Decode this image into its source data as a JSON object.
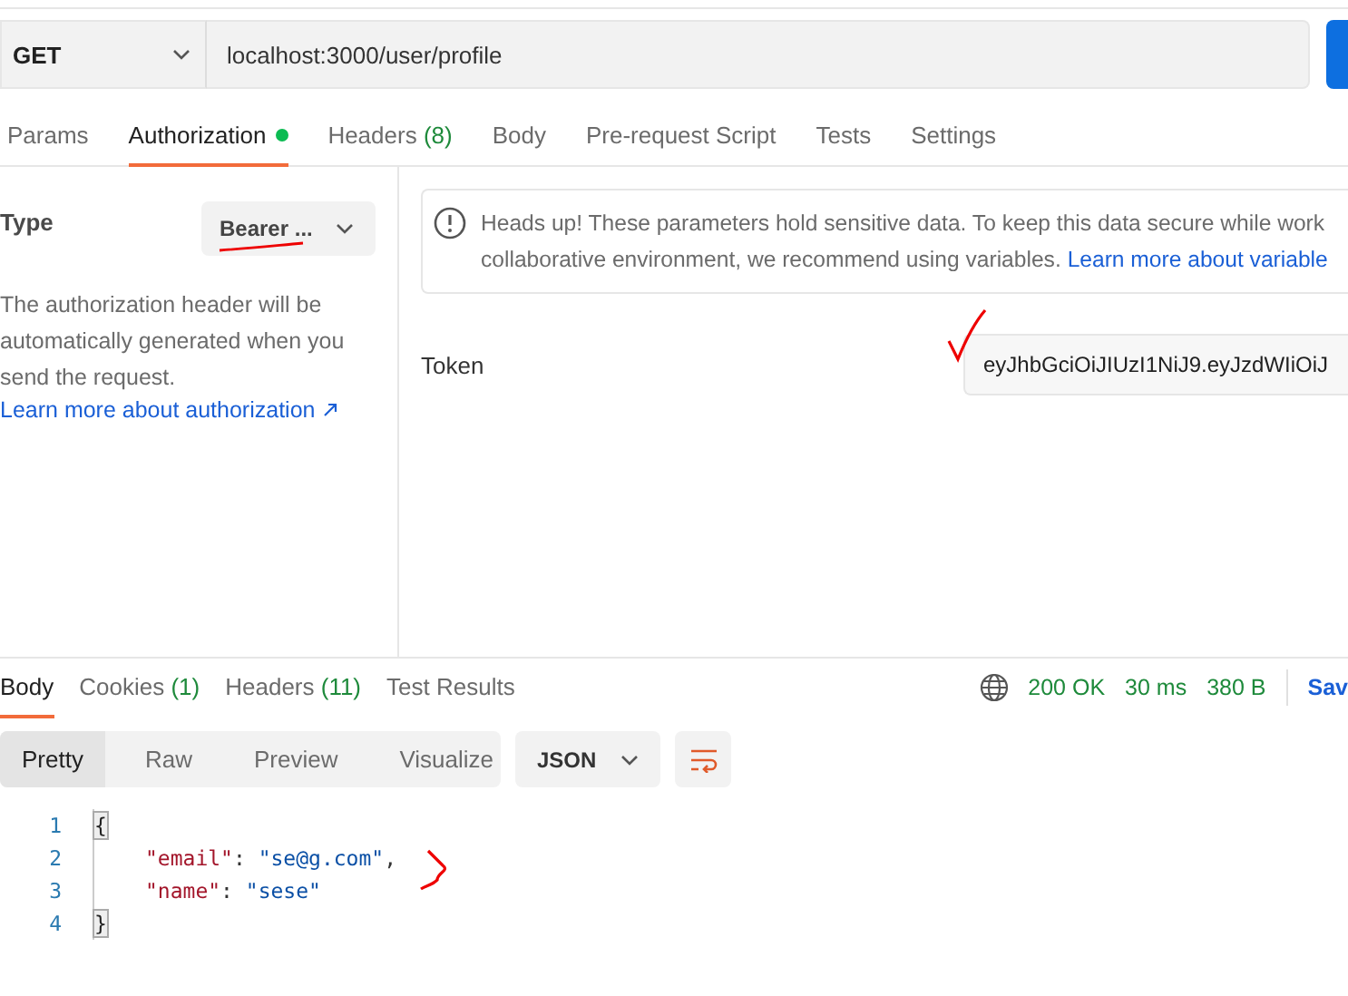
{
  "request": {
    "method": "GET",
    "url": "localhost:3000/user/profile"
  },
  "request_tabs": [
    {
      "label": "Params",
      "dot": false,
      "selected": false
    },
    {
      "label": "Authorization",
      "dot": true,
      "selected": true
    },
    {
      "label": "Headers",
      "count": "(8)",
      "dot": false,
      "selected": false
    },
    {
      "label": "Body",
      "dot": false,
      "selected": false
    },
    {
      "label": "Pre-request Script",
      "dot": false,
      "selected": false
    },
    {
      "label": "Tests",
      "dot": false,
      "selected": false
    },
    {
      "label": "Settings",
      "dot": false,
      "selected": false
    }
  ],
  "auth": {
    "type_label": "Type",
    "type_value": "Bearer ...",
    "description": "The authorization header will be automatically generated when you send the request.",
    "link": "Learn more about authorization"
  },
  "notice": {
    "text": "Heads up! These parameters hold sensitive data. To keep this data secure while work collaborative environment, we recommend using variables.",
    "link": "Learn more about variable"
  },
  "token": {
    "label": "Token",
    "value": "eyJhbGciOiJIUzI1NiJ9.eyJzdWIiOiJ"
  },
  "response_tabs": [
    {
      "label": "Body",
      "selected": true
    },
    {
      "label": "Cookies",
      "count": "(1)",
      "selected": false
    },
    {
      "label": "Headers",
      "count": "(11)",
      "selected": false
    },
    {
      "label": "Test Results",
      "selected": false
    }
  ],
  "response_meta": {
    "status": "200 OK",
    "time": "30 ms",
    "size": "380 B",
    "save": "Sav"
  },
  "view_modes": [
    {
      "label": "Pretty",
      "selected": true
    },
    {
      "label": "Raw",
      "selected": false
    },
    {
      "label": "Preview",
      "selected": false
    },
    {
      "label": "Visualize",
      "selected": false
    }
  ],
  "format": "JSON",
  "code_lines": [
    {
      "number": "1",
      "kind": "brace",
      "text": "{"
    },
    {
      "number": "2",
      "kind": "pair",
      "key": "\"email\"",
      "separator": ":",
      "value": "\"se@g.com\"",
      "trail": ","
    },
    {
      "number": "3",
      "kind": "pair",
      "key": "\"name\"",
      "separator": ":",
      "value": "\"sese\""
    },
    {
      "number": "4",
      "kind": "brace",
      "text": "}"
    }
  ]
}
